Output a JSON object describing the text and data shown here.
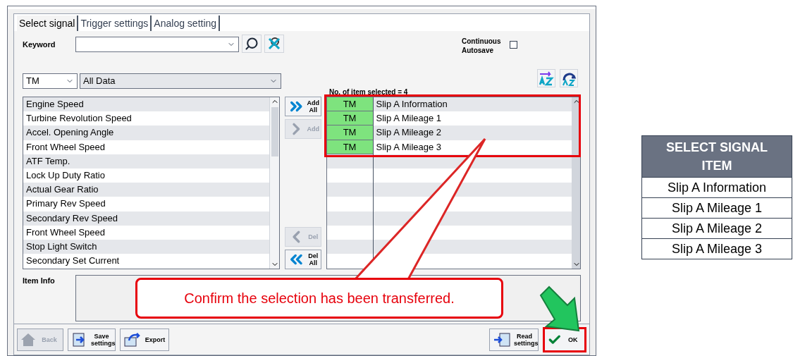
{
  "tabs": [
    {
      "label": "Select signal",
      "selected": true
    },
    {
      "label": "Trigger settings",
      "selected": false
    },
    {
      "label": "Analog setting",
      "selected": false
    }
  ],
  "keyword": {
    "label": "Keyword"
  },
  "autosave": {
    "label": "Continuous Autosave",
    "checked": false
  },
  "category": {
    "value": "TM"
  },
  "filter": {
    "value": "All Data"
  },
  "signals": [
    "Engine Speed",
    "Turbine Revolution Speed",
    "Accel. Opening Angle",
    "Front Wheel Speed",
    "ATF Temp.",
    "Lock Up Duty Ratio",
    "Actual Gear Ratio",
    "Primary Rev Speed",
    "Secondary Rev Speed",
    "Front Wheel Speed",
    "Stop Light Switch",
    "Secondary Set Current"
  ],
  "transfer_buttons": [
    {
      "kind": "add_all",
      "label": "Add All",
      "disabled": false
    },
    {
      "kind": "add",
      "label": "Add",
      "disabled": true
    },
    {
      "kind": "del",
      "label": "Del",
      "disabled": true
    },
    {
      "kind": "del_all",
      "label": "Del All",
      "disabled": false
    }
  ],
  "selected_count": "No. of item selected = 4",
  "selected_items": [
    {
      "system": "TM",
      "name": "Slip A Information"
    },
    {
      "system": "TM",
      "name": "Slip A Mileage 1"
    },
    {
      "system": "TM",
      "name": "Slip A Mileage 2"
    },
    {
      "system": "TM",
      "name": "Slip A Mileage 3"
    }
  ],
  "item_info": {
    "label": "Item Info"
  },
  "callout": "Confirm the selection has been transferred.",
  "footer_buttons": [
    {
      "kind": "back",
      "label": "Back",
      "disabled": true
    },
    {
      "kind": "save",
      "label": "Save settings",
      "disabled": false
    },
    {
      "kind": "export",
      "label": "Export",
      "disabled": false
    },
    {
      "kind": "read",
      "label": "Read settings",
      "disabled": false
    },
    {
      "kind": "ok",
      "label": "OK",
      "disabled": false
    }
  ],
  "side_table": {
    "header": "SELECT SIGNAL ITEM",
    "rows": [
      "Slip A Information",
      "Slip A Mileage 1",
      "Slip A Mileage 2",
      "Slip A Mileage 3"
    ]
  }
}
